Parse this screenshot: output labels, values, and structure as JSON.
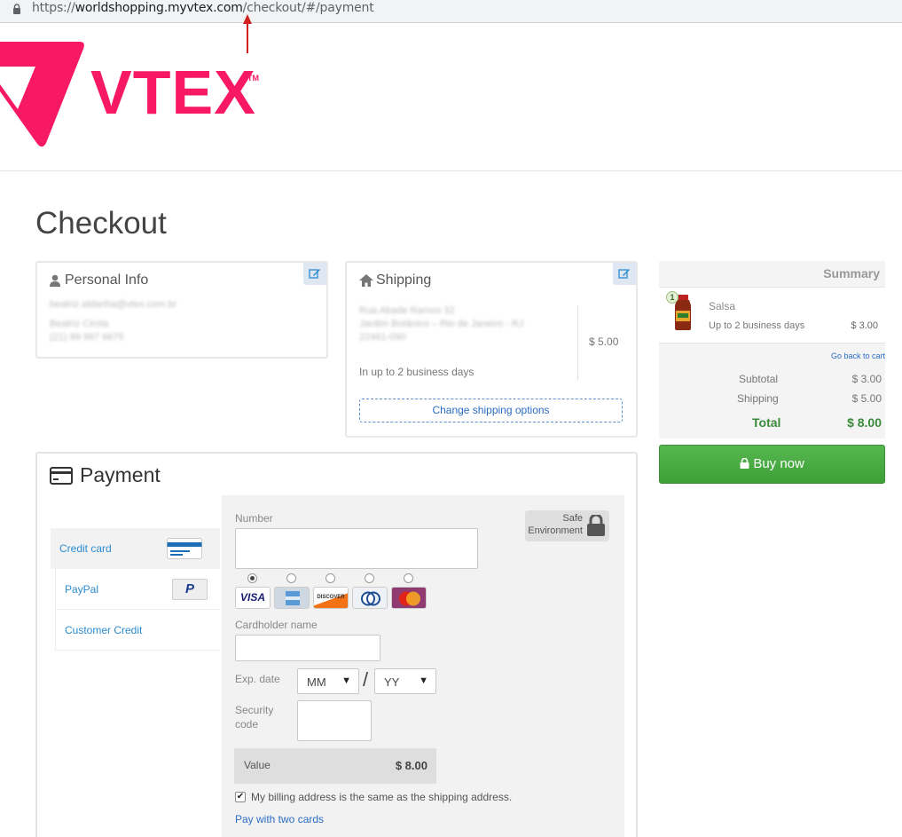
{
  "browser": {
    "url_prefix": "https://",
    "url_host": "worldshopping.myvtex.com",
    "url_path": "/checkout/#/payment"
  },
  "brand": {
    "name": "VTEX",
    "tm": "TM",
    "color": "#f71963"
  },
  "page_title": "Checkout",
  "personal_info": {
    "title": "Personal Info",
    "email": "beatriz.aldanha@vtex.com.br",
    "name": "Beatriz Cirola",
    "phone": "(21) 99 987 6675"
  },
  "shipping": {
    "title": "Shipping",
    "address_line1": "Rua Abade Ramos 32",
    "address_line2": "Jardim Botânico – Rio de Janeiro - RJ",
    "address_line3": "22461-090",
    "price": "$ 5.00",
    "estimate": "In up to 2 business days",
    "change_label": "Change shipping options"
  },
  "summary": {
    "title": "Summary",
    "item": {
      "qty": "1",
      "name": "Salsa",
      "delivery": "Up to 2 business days",
      "price": "$ 3.00"
    },
    "back_link": "Go back to cart",
    "subtotal_label": "Subtotal",
    "subtotal": "$ 3.00",
    "shipping_label": "Shipping",
    "shipping": "$ 5.00",
    "total_label": "Total",
    "total": "$ 8.00",
    "buy_label": "Buy now"
  },
  "payment": {
    "title": "Payment",
    "methods": [
      {
        "label": "Credit card",
        "active": true
      },
      {
        "label": "PayPal",
        "active": false
      },
      {
        "label": "Customer Credit",
        "active": false
      }
    ],
    "safe_line1": "Safe",
    "safe_line2": "Environment",
    "number_label": "Number",
    "brands": [
      "VISA",
      "AMEX",
      "DISCOVER",
      "Diners",
      "MasterCard"
    ],
    "selected_brand": "VISA",
    "cardholder_label": "Cardholder name",
    "exp_label": "Exp. date",
    "month_value": "MM",
    "year_value": "YY",
    "slash": "/",
    "security_label_1": "Security",
    "security_label_2": "code",
    "value_label": "Value",
    "value": "$ 8.00",
    "billing_same_label": "My billing address is the same as the shipping address.",
    "billing_same_checked": true,
    "two_cards_label": "Pay with two cards"
  },
  "colors": {
    "accent_blue": "#2c8ccf",
    "buy_green": "#4aab43",
    "total_green": "#3a8a3a"
  }
}
